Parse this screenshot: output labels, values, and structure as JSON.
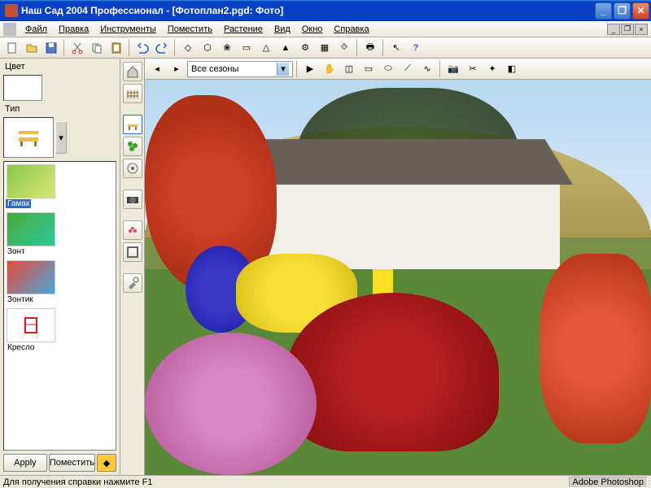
{
  "window": {
    "title": "Наш Сад 2004 Профессионал - [Фотоплан2.pgd: Фото]"
  },
  "menu": {
    "file": "Файл",
    "edit": "Правка",
    "tools": "Инструменты",
    "place": "Поместить",
    "plant": "Растение",
    "view": "Вид",
    "window": "Окно",
    "help": "Справка"
  },
  "left": {
    "color_label": "Цвет",
    "type_label": "Тип",
    "items": [
      {
        "label": "Гамак",
        "c1": "#88c850",
        "c2": "#d8e870"
      },
      {
        "label": "Зонт",
        "c1": "#48a838",
        "c2": "#30c898"
      },
      {
        "label": "Зонтик",
        "c1": "#e84838",
        "c2": "#48a8d8"
      },
      {
        "label": "Кресло",
        "c1": "#ffffff",
        "c2": "#e02828"
      }
    ],
    "apply": "Apply",
    "place_btn": "Поместить"
  },
  "toolbar2": {
    "season": "Все сезоны"
  },
  "status": {
    "left": "Для получения справки нажмите F1",
    "right": "Adobe Photoshop"
  }
}
